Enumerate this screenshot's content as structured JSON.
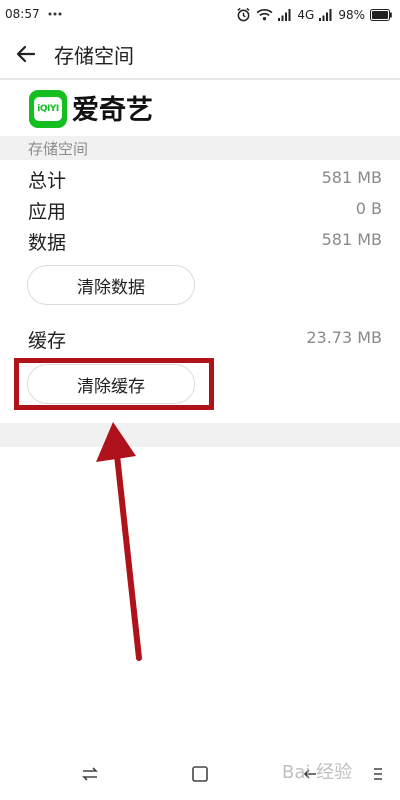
{
  "status_bar": {
    "time": "08:57",
    "network": "4G",
    "battery": "98%"
  },
  "app_bar": {
    "title": "存储空间"
  },
  "app_info": {
    "logo_text": "iQIYI",
    "name": "爱奇艺"
  },
  "storage": {
    "section_title": "存储空间",
    "rows": [
      {
        "label": "总计",
        "value": "581 MB"
      },
      {
        "label": "应用",
        "value": "0 B"
      },
      {
        "label": "数据",
        "value": "581 MB"
      }
    ],
    "clear_data_label": "清除数据"
  },
  "cache": {
    "label": "缓存",
    "value": "23.73 MB",
    "clear_cache_label": "清除缓存"
  },
  "annotation": {
    "color": "#b0121c"
  },
  "watermark": {
    "text": "Bai 经验"
  }
}
